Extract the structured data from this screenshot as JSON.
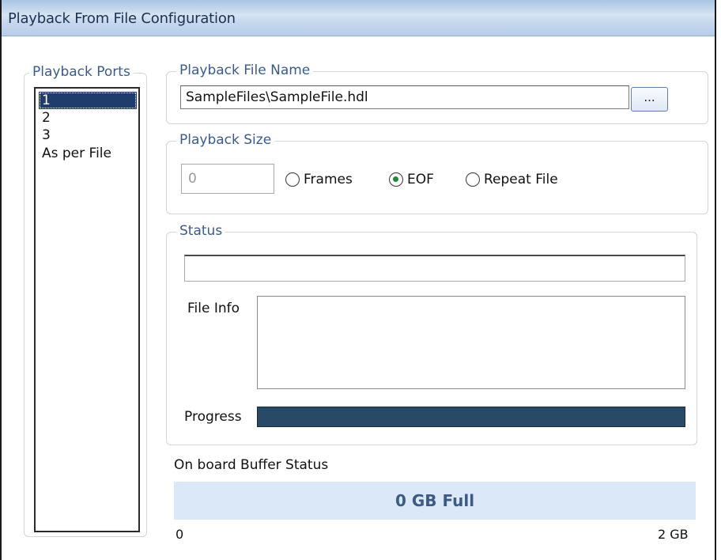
{
  "window": {
    "title": "Playback From File Configuration"
  },
  "ports": {
    "legend": "Playback Ports",
    "items": [
      {
        "label": "1",
        "selected": true
      },
      {
        "label": "2",
        "selected": false
      },
      {
        "label": "3",
        "selected": false
      },
      {
        "label": "As per File",
        "selected": false
      }
    ]
  },
  "file": {
    "legend": "Playback File Name",
    "value": "SampleFiles\\SampleFile.hdl",
    "browse_label": "..."
  },
  "size": {
    "legend": "Playback Size",
    "frames_value": "0",
    "options": [
      {
        "label": "Frames",
        "checked": false
      },
      {
        "label": "EOF",
        "checked": true
      },
      {
        "label": "Repeat File",
        "checked": false
      }
    ]
  },
  "status": {
    "legend": "Status",
    "status_text": "",
    "file_info_label": "File Info",
    "file_info_value": "",
    "progress_label": "Progress",
    "progress_percent": 100
  },
  "buffer": {
    "label": "On board Buffer Status",
    "value_text": "0 GB Full",
    "fill_percent": 0,
    "scale_min": "0",
    "scale_max": "2 GB"
  },
  "colors": {
    "selection": "#1f3c6c",
    "legend_text": "#3a5a8a",
    "progress_fill": "#284a67",
    "buffer_bg": "#dbe8f8",
    "radio_dot": "#1f8a3a"
  }
}
